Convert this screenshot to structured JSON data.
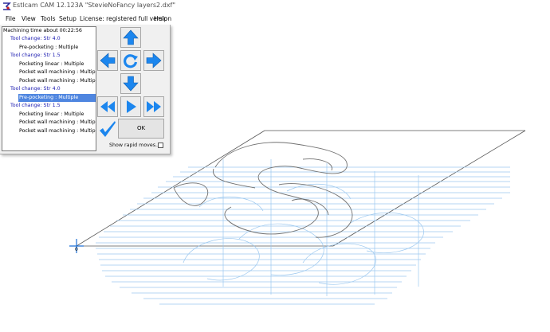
{
  "titlebar": {
    "title": "Estlcam CAM 12.123A \"StevieNoFancy layers2.dxf\""
  },
  "menu": {
    "items": [
      "File",
      "View",
      "Tools",
      "Setup",
      "License: registered full version",
      "Help"
    ]
  },
  "operations": {
    "machining_time": "Machining time about 00:22:56",
    "items": [
      {
        "label": "Tool change: Str 4.0",
        "kind": "tool"
      },
      {
        "label": "Pre-pocketing : Multiple",
        "kind": "op"
      },
      {
        "label": "Tool change: Str 1.5",
        "kind": "tool"
      },
      {
        "label": "Pocketing linear : Multiple",
        "kind": "op"
      },
      {
        "label": "Pocket wall machining : Multiple",
        "kind": "op"
      },
      {
        "label": "Pocket wall machining : Multiple",
        "kind": "op"
      },
      {
        "label": "Tool change: Str 4.0",
        "kind": "tool"
      },
      {
        "label": "Pre-pocketing : Multiple",
        "kind": "op",
        "selected": true
      },
      {
        "label": "Tool change: Str 1.5",
        "kind": "tool"
      },
      {
        "label": "Pocketing linear : Multiple",
        "kind": "op"
      },
      {
        "label": "Pocket wall machining : Multiple",
        "kind": "op"
      },
      {
        "label": "Pocket wall machining : Multiple",
        "kind": "op"
      }
    ]
  },
  "controls": {
    "ok_label": "OK",
    "show_rapid_label": "Show rapid moves...:",
    "show_rapid_checked": false
  },
  "viewport": {
    "origin_label": "0"
  },
  "colors": {
    "accent": "#1c86ee",
    "selection": "#4f86e0",
    "toolpath": "#9cc8ef",
    "tool_label": "#1a1ab0"
  }
}
